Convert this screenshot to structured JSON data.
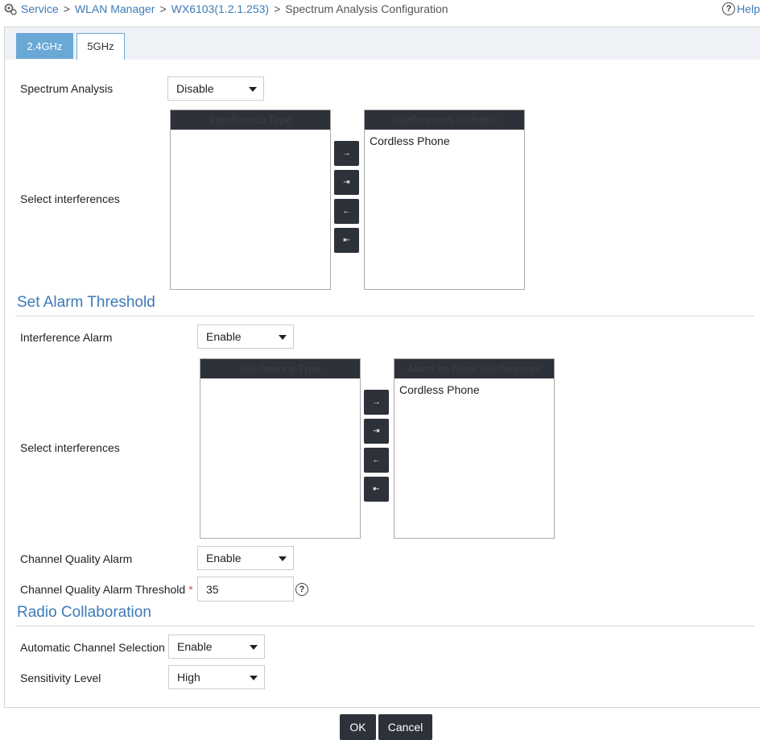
{
  "breadcrumb": {
    "items": [
      "Service",
      "WLAN Manager",
      "WX6103(1.2.1.253)"
    ],
    "separator": ">",
    "current": "Spectrum Analysis Configuration"
  },
  "help": {
    "label": "Help"
  },
  "tabs": [
    {
      "label": "2.4GHz",
      "active": true
    },
    {
      "label": "5GHz",
      "active": false
    }
  ],
  "spectrum": {
    "label": "Spectrum Analysis",
    "value": "Disable",
    "select_label": "Select interferences",
    "available_header": "Interference Type",
    "selected_header": "Interferences to detect",
    "selected_items": [
      "Cordless Phone"
    ]
  },
  "move_buttons": {
    "add": "→",
    "add_all": "⇥",
    "remove": "←",
    "remove_all": "⇤"
  },
  "alarm": {
    "section_title": "Set Alarm Threshold",
    "interference_alarm_label": "Interference Alarm",
    "interference_alarm_value": "Enable",
    "select_label": "Select interferences",
    "available_header": "Interference Type",
    "selected_header": "Alarm on these interferences",
    "selected_items": [
      "Cordless Phone"
    ],
    "channel_quality_label": "Channel Quality Alarm",
    "channel_quality_value": "Enable",
    "threshold_label": "Channel Quality Alarm Threshold",
    "required_mark": "*",
    "threshold_value": "35"
  },
  "radio": {
    "section_title": "Radio Collaboration",
    "auto_channel_label": "Automatic Channel Selection",
    "auto_channel_value": "Enable",
    "sensitivity_label": "Sensitivity Level",
    "sensitivity_value": "High"
  },
  "actions": {
    "ok": "OK",
    "cancel": "Cancel"
  },
  "colors": {
    "accent": "#3d7ab8",
    "tab_active": "#6aa8d6",
    "dark_button": "#2d313a"
  }
}
